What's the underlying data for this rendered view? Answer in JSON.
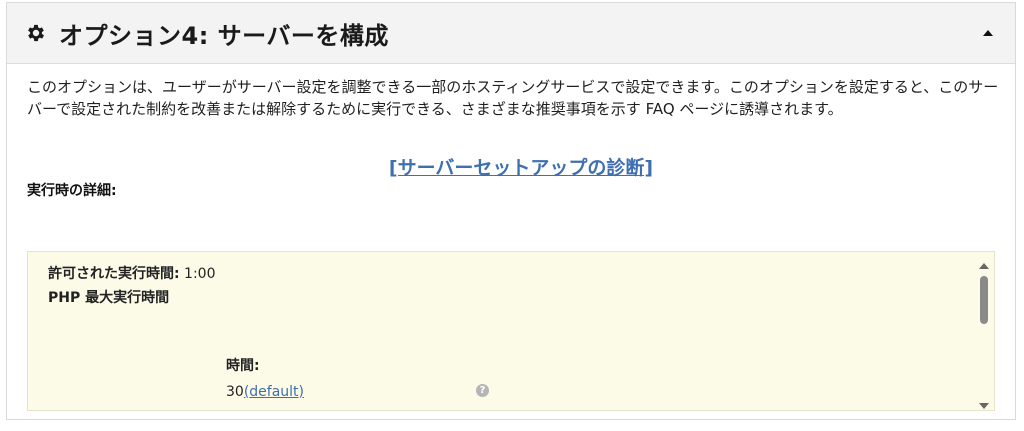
{
  "header": {
    "title": "オプション4: サーバーを構成",
    "gear_icon": "gear-icon",
    "toggle_icon": "caret-up-icon"
  },
  "body": {
    "description": "このオプションは、ユーザーがサーバー設定を調整できる一部のホスティングサービスで設定できます。このオプションを設定すると、このサーバーで設定された制約を改善または解除するために実行できる、さまざまな推奨事項を示す FAQ ページに誘導されます。",
    "diagnostics_link": "[サーバーセットアップの診断]",
    "details_label": "実行時の詳細:"
  },
  "details": {
    "allowed_time_label": "許可された実行時間:",
    "allowed_time_value": " 1:00",
    "php_max_label": "PHP 最大実行時間",
    "time_label": "時間:",
    "time_value": "30",
    "default_link": " (default)",
    "help_icon": "help-icon",
    "help_glyph": "?"
  },
  "colors": {
    "link": "#3e6fb0",
    "details_bg": "#fcfbe8",
    "header_bg": "#f3f3f3"
  }
}
